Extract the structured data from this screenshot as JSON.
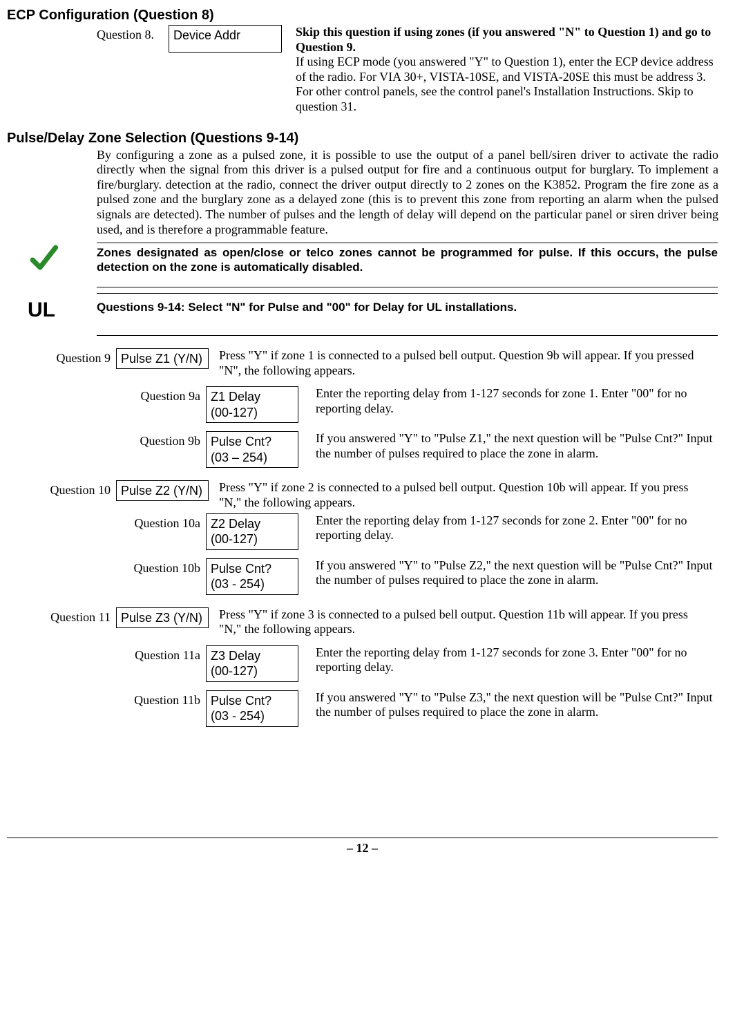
{
  "ecp_heading": "ECP Configuration (Question 8)",
  "q8": {
    "label": "Question 8.",
    "box": "Device Addr",
    "desc_bold": "Skip this question if using zones (if you answered \"N\" to Question 1) and go to Question 9.",
    "desc_rest": "If using ECP mode (you answered \"Y\" to Question 1), enter the ECP device address of the radio.  For VIA 30+, VISTA-10SE, and VISTA-20SE this must be address 3.  For other control panels, see the control panel's Installation Instructions.  Skip to question 31."
  },
  "pulse_heading": "Pulse/Delay Zone Selection (Questions 9-14)",
  "pulse_intro": "By configuring a zone as a pulsed zone, it is possible to use the output of a panel bell/siren driver to activate the radio directly when the signal from this driver is a pulsed output for fire and a continuous output for burglary.  To implement a fire/burglary. detection at the radio, connect the driver output directly to 2 zones on the K3852. Program the fire zone as a pulsed zone and the burglary zone as a delayed zone (this is to prevent this zone from reporting an alarm when the pulsed signals are detected).  The number of pulses and the length of delay will depend on the particular panel or siren driver being used, and is therefore a programmable feature.",
  "note_check": "Zones designated as open/close or telco zones cannot be programmed for pulse. If this occurs, the pulse detection on the zone is automatically disabled.",
  "ul_badge": "UL",
  "ul_text": "Questions 9-14: Select \"N\" for Pulse and \"00\" for Delay for UL installations.",
  "q9": {
    "label": "Question 9",
    "box": "Pulse Z1 (Y/N)",
    "desc": "Press \"Y\" if zone 1 is connected to a pulsed bell output. Question 9b will appear.  If you pressed \"N\", the following appears."
  },
  "q9a": {
    "label": "Question 9a",
    "box_l1": "Z1 Delay",
    "box_l2": "(00-127)",
    "desc": "Enter the reporting delay from 1-127 seconds for zone 1.  Enter \"00\" for no reporting delay."
  },
  "q9b": {
    "label": "Question 9b",
    "box_l1": "Pulse Cnt?",
    "box_l2": "(03 – 254)",
    "desc": "If you answered \"Y\" to \"Pulse Z1,\" the next question will be \"Pulse Cnt?\"  Input the number of pulses required to place the zone in alarm."
  },
  "q10": {
    "label": "Question 10",
    "box": "Pulse Z2 (Y/N)",
    "desc": "Press \"Y\" if zone 2 is connected to a pulsed bell output. Question 10b will appear.  If you press \"N,\" the following appears."
  },
  "q10a": {
    "label": "Question 10a",
    "box_l1": "Z2 Delay",
    "box_l2": "(00-127)",
    "desc": "Enter the reporting delay from 1-127 seconds for zone 2.  Enter \"00\" for no reporting delay."
  },
  "q10b": {
    "label": "Question 10b",
    "box_l1": "Pulse Cnt?",
    "box_l2": "(03 - 254)",
    "desc": "If you answered \"Y\" to \"Pulse Z2,\" the next question will be \"Pulse Cnt?\"  Input the number of pulses required to place the zone in alarm."
  },
  "q11": {
    "label": "Question 11",
    "box": "Pulse Z3 (Y/N)",
    "desc": "Press \"Y\" if zone 3 is connected to a pulsed bell output. Question 11b will appear.  If you press \"N,\" the following appears."
  },
  "q11a": {
    "label": "Question 11a",
    "box_l1": "Z3 Delay",
    "box_l2": "(00-127)",
    "desc": "Enter the reporting delay from 1-127 seconds for zone 3.  Enter \"00\" for no reporting delay."
  },
  "q11b": {
    "label": "Question 11b",
    "box_l1": "Pulse Cnt?",
    "box_l2": "(03 - 254)",
    "desc": "If you answered \"Y\" to \"Pulse Z3,\" the next question will be \"Pulse Cnt?\"  Input the number of pulses required to place the zone in alarm."
  },
  "page_number": "– 12 –"
}
